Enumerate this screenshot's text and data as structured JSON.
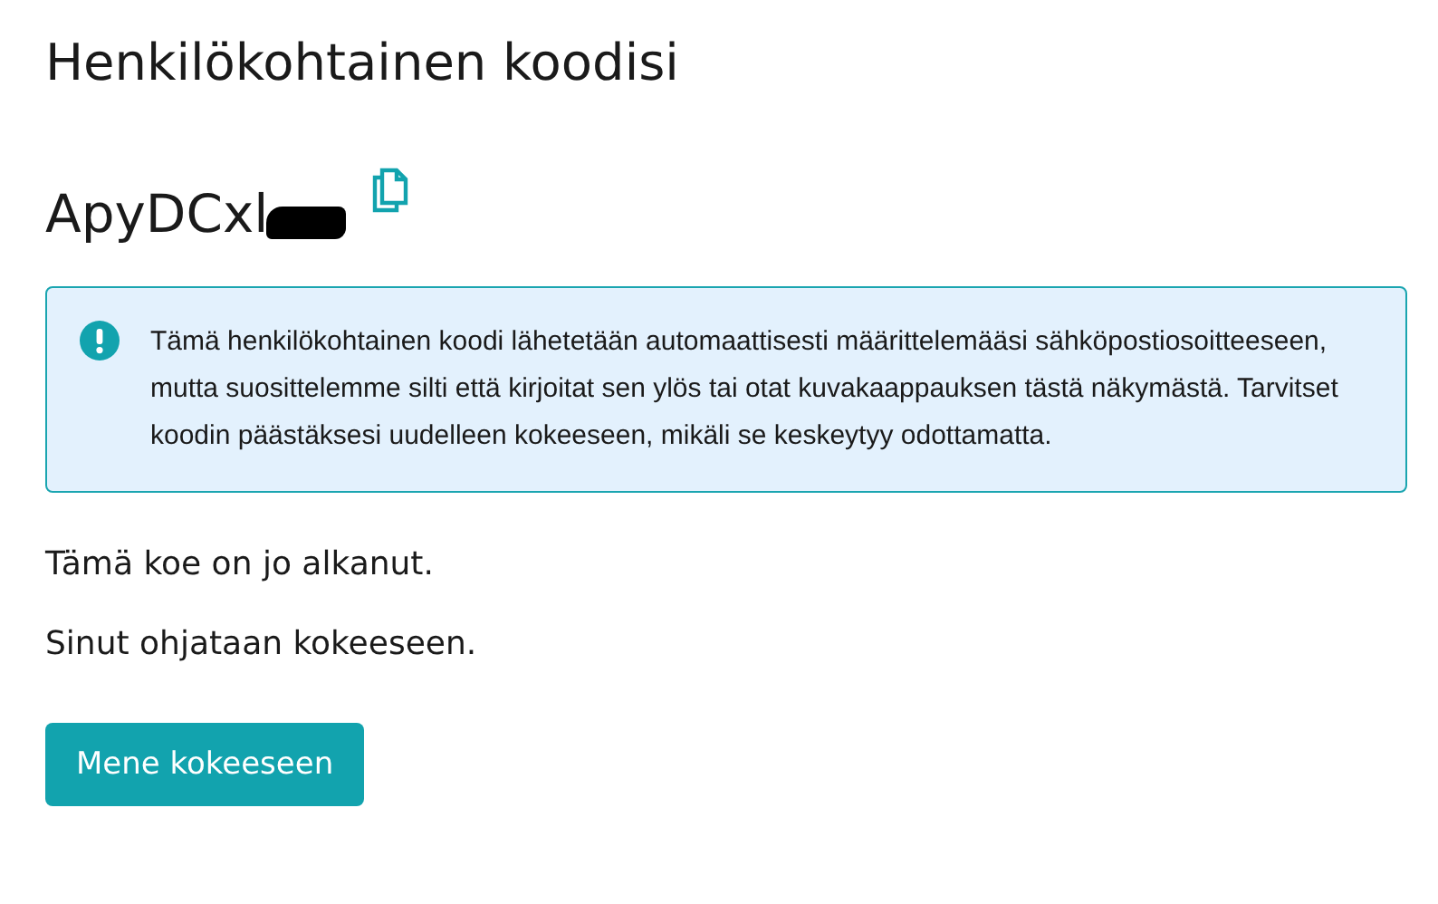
{
  "heading": "Henkilökohtainen koodisi",
  "code": "ApyDCxl",
  "notice": "Tämä henkilökohtainen koodi lähetetään automaattisesti määrittelemääsi sähköpostiosoitteeseen, mutta suosittelemme silti että kirjoitat sen ylös tai otat kuvakaappauksen tästä näkymästä. Tarvitset koodin päästäksesi uudelleen kokeeseen, mikäli se keskeytyy odottamatta.",
  "status_lines": [
    "Tämä koe on jo alkanut.",
    "Sinut ohjataan kokeeseen."
  ],
  "button": "Mene kokeeseen"
}
